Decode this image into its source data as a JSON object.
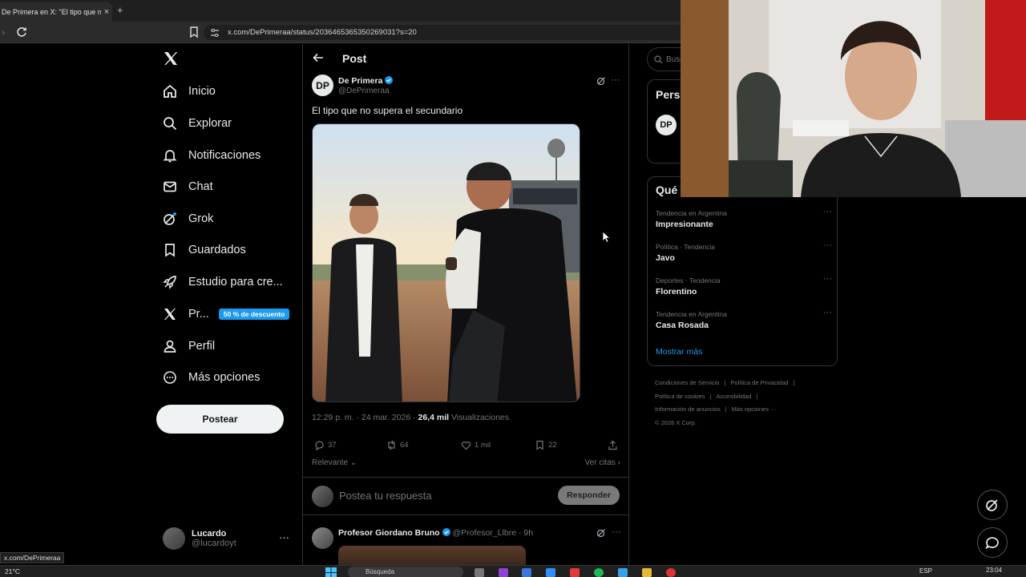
{
  "browser": {
    "tab_title": "De Primera en X: \"El tipo que no",
    "tab_close": "×",
    "new_tab": "+",
    "url": "x.com/DePrimeraa/status/2036465365350269031?s=20"
  },
  "nav": {
    "items": [
      {
        "label": "Inicio",
        "icon": "home-icon"
      },
      {
        "label": "Explorar",
        "icon": "search-icon"
      },
      {
        "label": "Notificaciones",
        "icon": "bell-icon"
      },
      {
        "label": "Chat",
        "icon": "mail-icon"
      },
      {
        "label": "Grok",
        "icon": "grok-icon"
      },
      {
        "label": "Guardados",
        "icon": "bookmark-icon"
      },
      {
        "label": "Estudio para cre...",
        "icon": "rocket-icon"
      },
      {
        "label": "Pr...",
        "icon": "x-icon"
      },
      {
        "label": "Perfil",
        "icon": "person-icon"
      },
      {
        "label": "Más opciones",
        "icon": "more-circle-icon"
      }
    ],
    "premium_badge": "50 % de descuento",
    "post_button": "Postear",
    "account": {
      "name": "Lucardo",
      "handle": "@lucardoyt",
      "more": "···"
    }
  },
  "post": {
    "header_title": "Post",
    "author_name": "De Primera",
    "author_handle": "@DePrimeraa",
    "author_initials": "DP",
    "more": "···",
    "text": "El tipo que no supera el secundario",
    "time": "12:29 p. m. · 24 mar. 2026 · ",
    "views": "26,4 mil",
    "views_label": " Visualizaciones",
    "stats": {
      "replies": "37",
      "reposts": "64",
      "likes": "1 mil",
      "bookmarks": "22"
    },
    "sort_label": "Relevante",
    "quotes_label": "Ver citas ›",
    "reply_placeholder": "Postea tu respuesta",
    "reply_button": "Responder"
  },
  "reply": {
    "name": "Profesor Giordano Bruno",
    "handle": " @Profesor_Llbre · 9h",
    "more": "···"
  },
  "sidebar": {
    "search_placeholder": "Busc",
    "people_title": "Perso",
    "people_initials": "DP",
    "trends_title": "Qué",
    "trends": [
      {
        "context": "Tendencia en Argentina",
        "name": "Impresionante"
      },
      {
        "context": "Política · Tendencia",
        "name": "Javo"
      },
      {
        "context": "Deportes · Tendencia",
        "name": "Florentino"
      },
      {
        "context": "Tendencia en Argentina",
        "name": "Casa Rosada"
      }
    ],
    "trend_more": "···",
    "show_more": "Mostrar más",
    "footer": [
      "Condiciones de Servicio",
      "|",
      "Política de Privacidad",
      "|",
      "Política de cookies",
      "|",
      "Accesibilidad",
      "|",
      "Información de anuncios",
      "|",
      "Más opciones ···",
      "© 2026 X Corp."
    ]
  },
  "status_url": "x.com/DePrimeraa",
  "taskbar": {
    "weather": "21°C",
    "search": "Búsqueda",
    "lang": "ESP",
    "clock": "23:04"
  },
  "colors": {
    "accent": "#1d9bf0",
    "background": "#000000",
    "border": "#2f3336",
    "muted": "#71767b"
  }
}
